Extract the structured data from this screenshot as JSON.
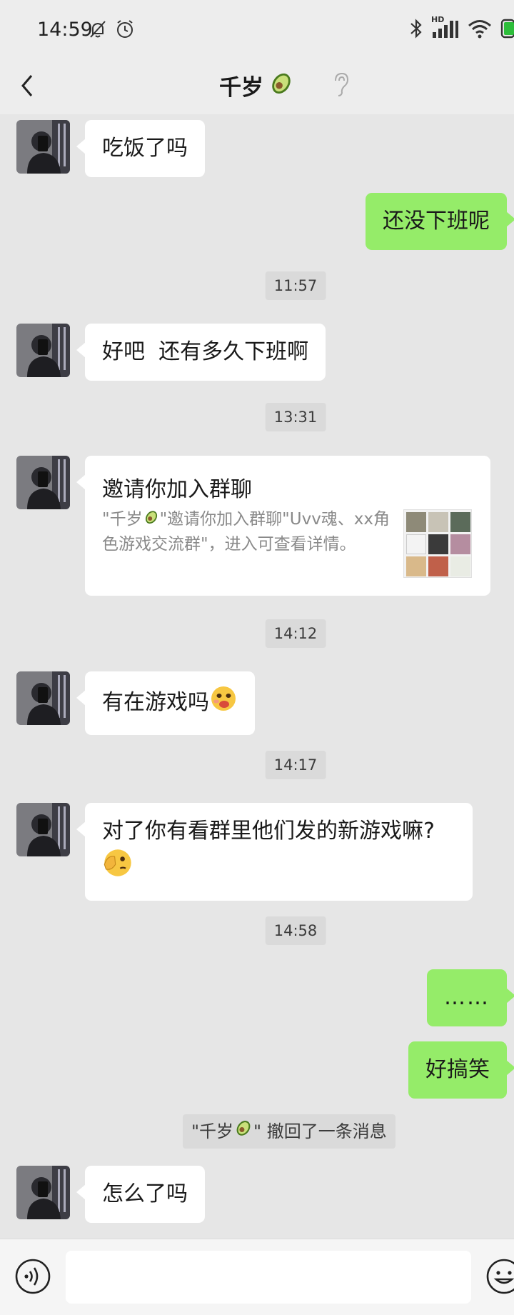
{
  "status_bar": {
    "time": "14:59",
    "network_label": "HD"
  },
  "nav": {
    "title": "千岁"
  },
  "messages": [
    {
      "side": "left",
      "text": "吃饭了吗"
    },
    {
      "side": "right",
      "text": "还没下班呢"
    },
    {
      "type": "timestamp",
      "text": "11:57"
    },
    {
      "side": "left",
      "text": "好吧  还有多久下班啊"
    },
    {
      "type": "timestamp",
      "text": "13:31"
    },
    {
      "side": "left",
      "type": "invite",
      "title": "邀请你加入群聊",
      "desc_prefix": "\"千岁",
      "desc_suffix": "\"邀请你加入群聊\"Uvv魂、xx角色游戏交流群\"，进入可查看详情。"
    },
    {
      "type": "timestamp",
      "text": "14:12"
    },
    {
      "side": "left",
      "text": "有在游戏吗"
    },
    {
      "type": "timestamp",
      "text": "14:17"
    },
    {
      "side": "left",
      "text": "对了你有看群里他们发的新游戏嘛?"
    },
    {
      "type": "timestamp",
      "text": "14:58"
    },
    {
      "side": "right",
      "text": "……"
    },
    {
      "side": "right",
      "text": "好搞笑"
    },
    {
      "type": "recall",
      "prefix": "\"千岁",
      "suffix": "\" 撤回了一条消息"
    },
    {
      "side": "left",
      "text": "怎么了吗"
    }
  ],
  "colors": {
    "self_bubble": "#95ec69",
    "other_bubble": "#ffffff",
    "background": "#e6e6e6"
  },
  "icons": {
    "back": "chevron-left-icon",
    "ear": "ear-icon",
    "voice": "voice-icon",
    "emoji": "smiley-icon"
  }
}
